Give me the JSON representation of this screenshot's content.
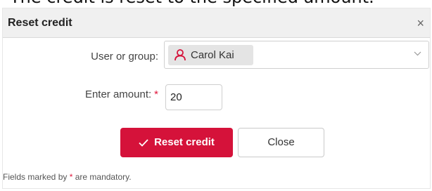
{
  "caption": "The credit is reset to the specified amount.",
  "dialog": {
    "title": "Reset credit",
    "close_glyph": "×"
  },
  "form": {
    "user_label": "User or group:",
    "user_value": "Carol Kai",
    "user_icon": "user-icon",
    "amount_label": "Enter amount:",
    "amount_value": "20",
    "required_mark": "*"
  },
  "buttons": {
    "reset_label": "Reset credit",
    "reset_icon": "check-icon",
    "close_label": "Close"
  },
  "footer": {
    "prefix": "Fields marked by",
    "mark": "*",
    "suffix": "are mandatory."
  },
  "colors": {
    "accent": "#d5123a",
    "required": "#e0173c"
  }
}
